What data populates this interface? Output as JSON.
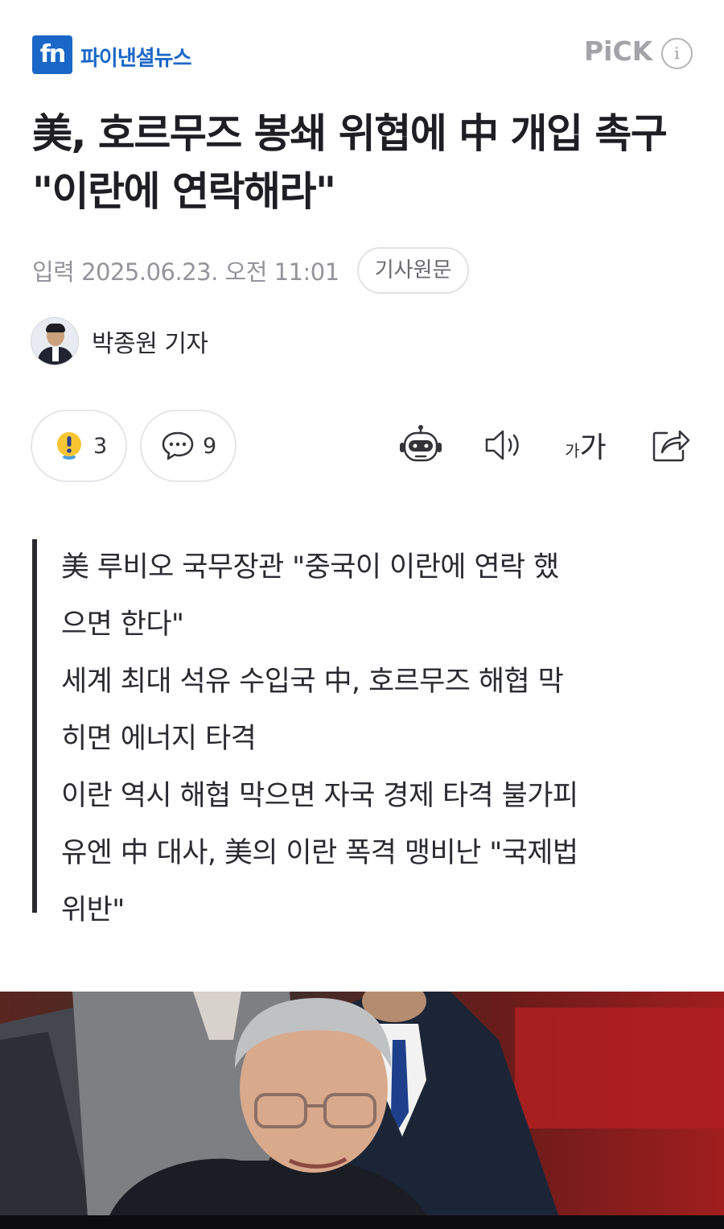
{
  "header": {
    "logo_mark": "fn",
    "logo_text": "파이낸셜뉴스",
    "pick_label": "PiCK",
    "info_symbol": "i"
  },
  "article": {
    "title": "美, 호르무즈 봉쇄 위협에 中 개입 촉구 \"이란에 연락해라\"",
    "date": "입력 2025.06.23. 오전 11:01",
    "original_button": "기사원문",
    "author": "박종원 기자"
  },
  "actions": {
    "reaction_count": "3",
    "comment_count": "9",
    "font_small": "가",
    "font_big": "가"
  },
  "summary": [
    "美 루비오 국무장관 \"중국이 이란에 연락 했",
    "으면 한다\"",
    "세계 최대 석유 수입국 中, 호르무즈 해협 막",
    "히면 에너지 타격",
    "이란 역시 해협 막으면 자국 경제 타격 불가피",
    "유엔 中 대사, 美의 이란 폭격 맹비난 \"국제법",
    "위반\""
  ],
  "colors": {
    "brand": "#1a67c8",
    "text": "#1e1e23",
    "muted": "#94949a"
  }
}
